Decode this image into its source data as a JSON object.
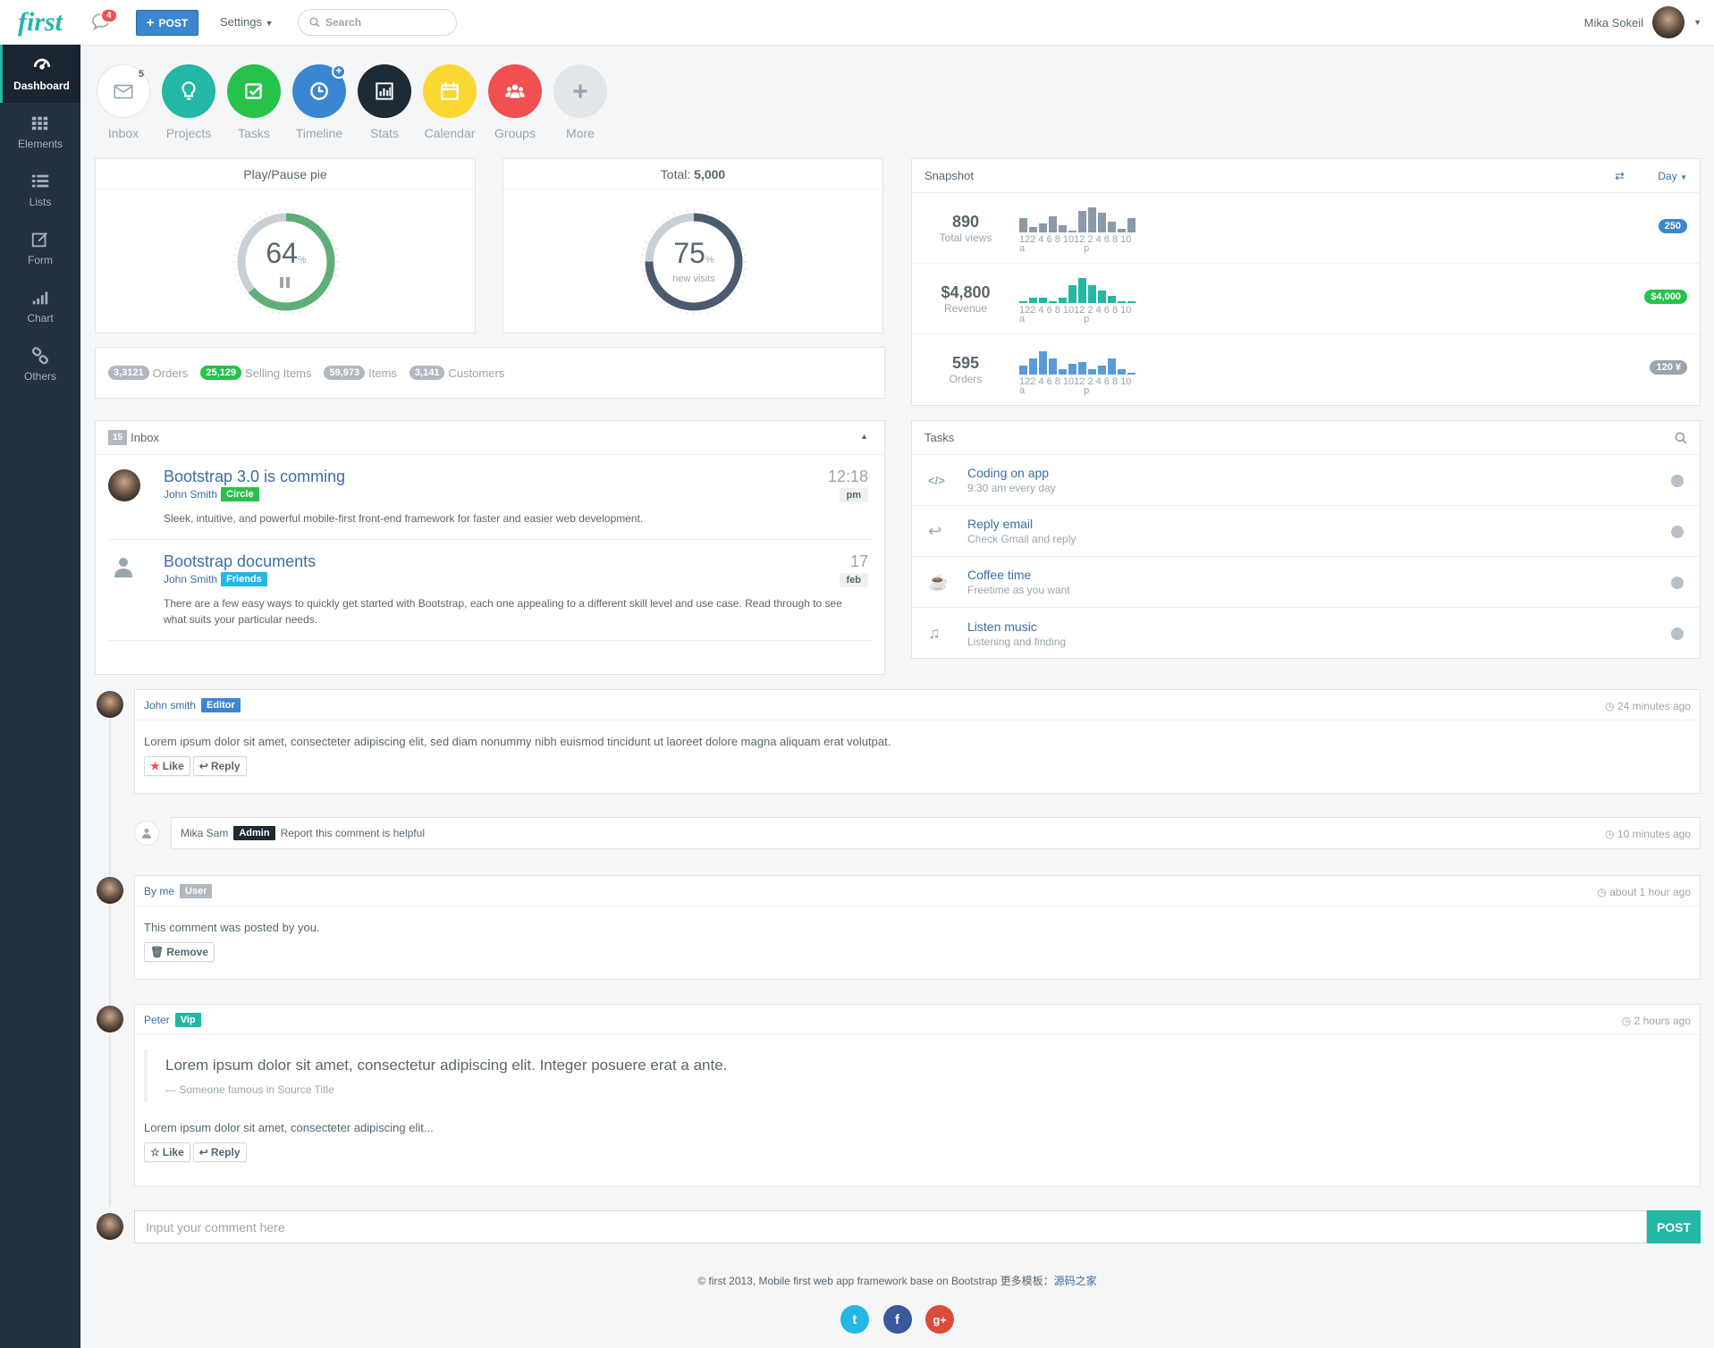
{
  "brand": "first",
  "sidebar": {
    "items": [
      {
        "label": "Dashboard",
        "icon": "dashboard-icon"
      },
      {
        "label": "Elements",
        "icon": "grid-icon"
      },
      {
        "label": "Lists",
        "icon": "list-icon"
      },
      {
        "label": "Form",
        "icon": "edit-icon"
      },
      {
        "label": "Chart",
        "icon": "signal-icon"
      },
      {
        "label": "Others",
        "icon": "link-icon"
      }
    ]
  },
  "topbar": {
    "notif_count": "4",
    "post_label": "POST",
    "settings_label": "Settings",
    "search_placeholder": "Search",
    "user_name": "Mika Sokeil"
  },
  "shortcuts": [
    {
      "label": "Inbox",
      "color": "#ffffff",
      "icon": "envelope-icon",
      "badge": "5"
    },
    {
      "label": "Projects",
      "color": "#23b7a5",
      "icon": "lightbulb-icon"
    },
    {
      "label": "Tasks",
      "color": "#27c24c",
      "icon": "check-icon"
    },
    {
      "label": "Timeline",
      "color": "#3a86d1",
      "icon": "clock-icon"
    },
    {
      "label": "Stats",
      "color": "#1c2b36",
      "icon": "bar-chart-icon"
    },
    {
      "label": "Calendar",
      "color": "#fad733",
      "icon": "calendar-icon"
    },
    {
      "label": "Groups",
      "color": "#f05050",
      "icon": "group-icon"
    },
    {
      "label": "More",
      "color": "#e4e7ea",
      "icon": "plus-icon"
    }
  ],
  "pie1": {
    "title": "Play/Pause pie",
    "value": "64",
    "unit": "%",
    "percent": 64
  },
  "pie2": {
    "title_prefix": "Total:",
    "title_value": "5,000",
    "value": "75",
    "unit": "%",
    "sub": "new visits",
    "percent": 75
  },
  "stats": [
    {
      "value": "3,3121",
      "label": "Orders",
      "color": "#b0b8c0"
    },
    {
      "value": "25,129",
      "label": "Selling Items",
      "color": "#27c24c"
    },
    {
      "value": "59,973",
      "label": "Items",
      "color": "#b0b8c0"
    },
    {
      "value": "3,141",
      "label": "Customers",
      "color": "#b0b8c0"
    }
  ],
  "snapshot": {
    "title": "Snapshot",
    "period": "Day",
    "ticks": "122 4 6 8 1012 2 4 6 8 10",
    "ampm": [
      "a",
      "p"
    ],
    "rows": [
      {
        "value": "890",
        "label": "Total views",
        "badge": "250",
        "badge_color": "#3a86d1",
        "bar_color": "#8a9aaa",
        "bars": [
          8,
          3,
          5,
          9,
          4,
          1,
          12,
          14,
          11,
          6,
          2,
          8
        ]
      },
      {
        "value": "$4,800",
        "label": "Revenue",
        "badge": "$4,000",
        "badge_color": "#27c24c",
        "bar_color": "#23b7a5",
        "bars": [
          1,
          3,
          3,
          1,
          3,
          10,
          14,
          10,
          7,
          4,
          1,
          1
        ]
      },
      {
        "value": "595",
        "label": "Orders",
        "badge": "120 ¥",
        "badge_color": "#9aa5ae",
        "bar_color": "#5a9ad8",
        "bars": [
          5,
          9,
          13,
          9,
          3,
          6,
          7,
          3,
          5,
          9,
          3,
          1
        ]
      }
    ]
  },
  "inbox": {
    "count": "15",
    "title": "Inbox",
    "messages": [
      {
        "title": "Bootstrap 3.0 is comming",
        "author": "John Smith",
        "tag": "Circle",
        "tag_color": "#27c24c",
        "body": "Sleek, intuitive, and powerful mobile-first front-end framework for faster and easier web development.",
        "time": "12:18",
        "time_sub": "pm"
      },
      {
        "title": "Bootstrap documents",
        "author": "John Smith",
        "tag": "Friends",
        "tag_color": "#23b7e5",
        "body": "There are a few easy ways to quickly get started with Bootstrap, each one appealing to a different skill level and use case. Read through to see what suits your particular needs.",
        "time": "17",
        "time_sub": "feb"
      }
    ]
  },
  "tasks": {
    "title": "Tasks",
    "items": [
      {
        "title": "Coding on app",
        "sub": "9:30 am every day",
        "icon": "code-icon"
      },
      {
        "title": "Reply email",
        "sub": "Check Gmail and reply",
        "icon": "reply-icon"
      },
      {
        "title": "Coffee time",
        "sub": "Freetime as you want",
        "icon": "coffee-icon"
      },
      {
        "title": "Listen music",
        "sub": "Listening and finding",
        "icon": "music-icon"
      }
    ]
  },
  "comments": {
    "c1": {
      "author": "John smith",
      "tag": "Editor",
      "ago": "24 minutes ago",
      "body": "Lorem ipsum dolor sit amet, consecteter adipiscing elit, sed diam nonummy nibh euismod tincidunt ut laoreet dolore magna aliquam erat volutpat.",
      "like": "Like",
      "reply": "Reply"
    },
    "c2": {
      "author": "Mika Sam",
      "tag": "Admin",
      "text": "Report this comment is helpful",
      "ago": "10 minutes ago"
    },
    "c3": {
      "author": "By me",
      "tag": "User",
      "ago": "about 1 hour ago",
      "body": "This comment was posted by you.",
      "remove": "Remove"
    },
    "c4": {
      "author": "Peter",
      "tag": "Vip",
      "ago": "2 hours ago",
      "quote": "Lorem ipsum dolor sit amet, consectetur adipiscing elit. Integer posuere erat a ante.",
      "quote_source": "— Someone famous in Source Title",
      "body": "Lorem ipsum dolor sit amet, consecteter adipiscing elit...",
      "like": "Like",
      "reply": "Reply"
    }
  },
  "comment_input": {
    "placeholder": "Input your comment here",
    "button": "POST"
  },
  "footer": {
    "text": "© first 2013, Mobile first web app framework base on Bootstrap 更多模板：",
    "link": "源码之家"
  }
}
